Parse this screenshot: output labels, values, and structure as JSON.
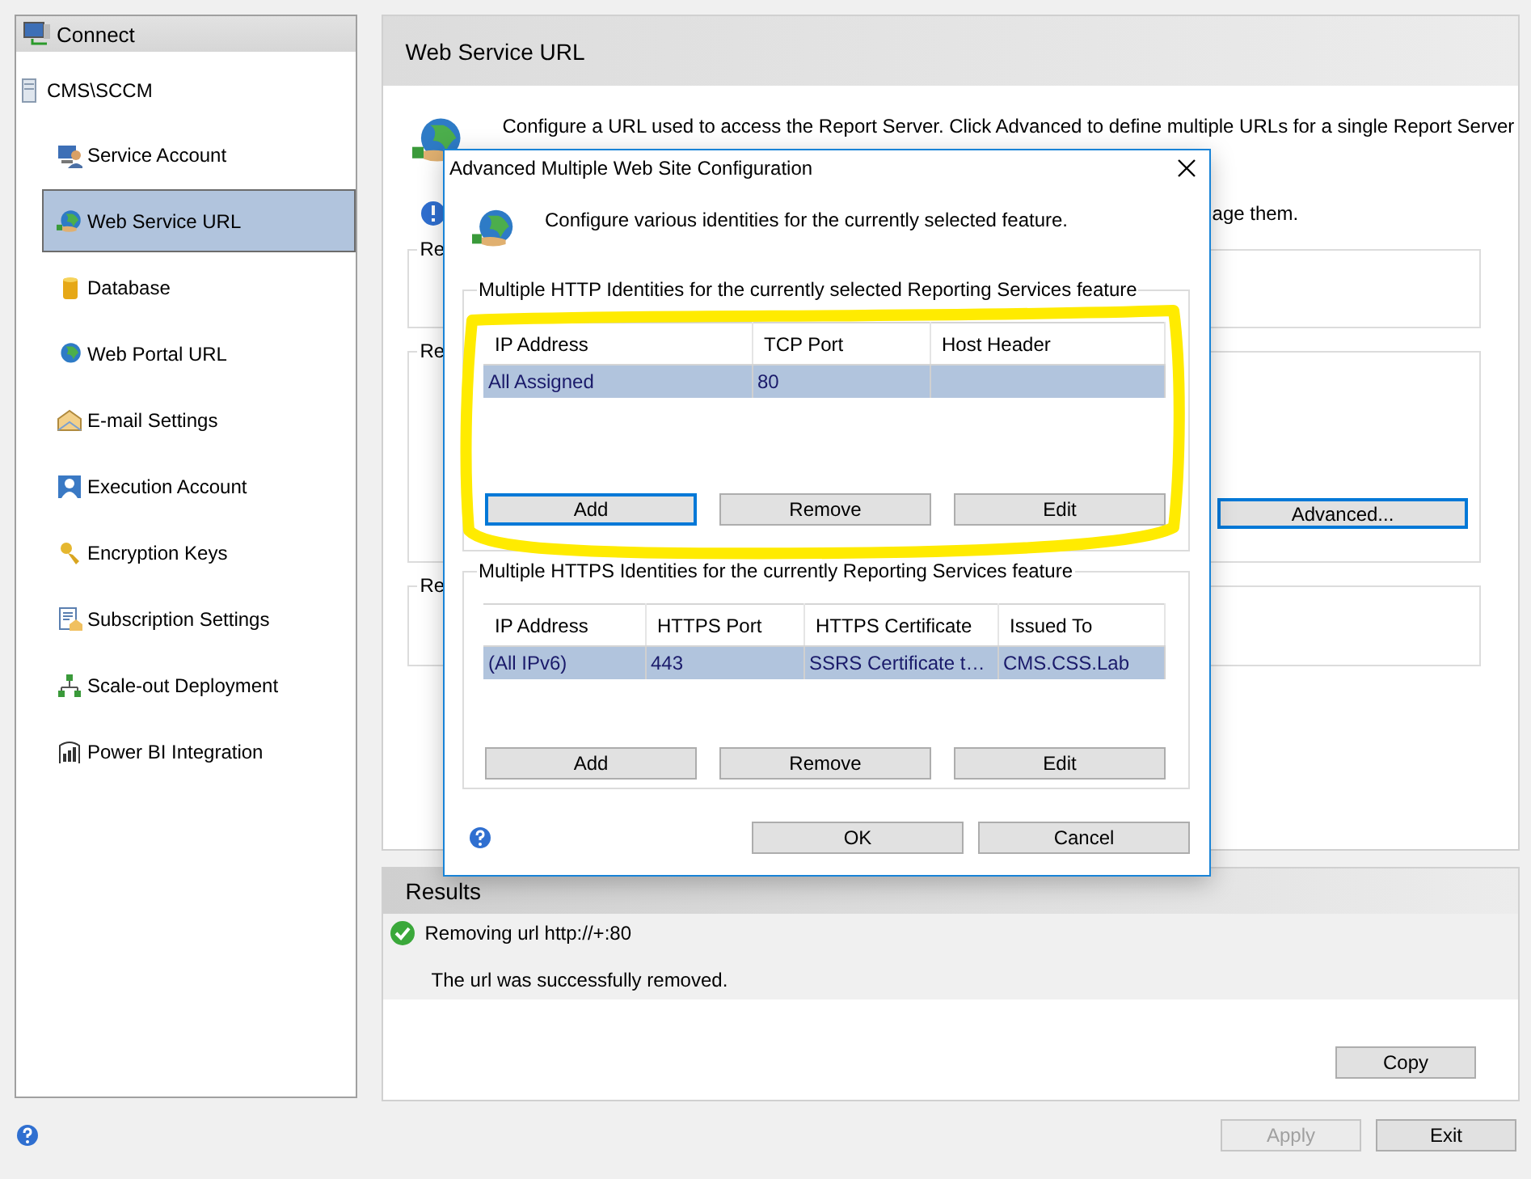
{
  "sidebar": {
    "title": "Connect",
    "server": "CMS\\SCCM",
    "items": [
      {
        "label": "Service Account",
        "selected": false
      },
      {
        "label": "Web Service URL",
        "selected": true
      },
      {
        "label": "Database",
        "selected": false
      },
      {
        "label": "Web Portal URL",
        "selected": false
      },
      {
        "label": "E-mail Settings",
        "selected": false
      },
      {
        "label": "Execution Account",
        "selected": false
      },
      {
        "label": "Encryption Keys",
        "selected": false
      },
      {
        "label": "Subscription Settings",
        "selected": false
      },
      {
        "label": "Scale-out Deployment",
        "selected": false
      },
      {
        "label": "Power BI Integration",
        "selected": false
      }
    ]
  },
  "page": {
    "title": "Web Service URL",
    "intro": "Configure a URL used to access the Report Server.  Click Advanced to define multiple URLs for a single Report Server",
    "info_fragment": "age them.",
    "groups": [
      {
        "legend": "Re"
      },
      {
        "legend": "Re",
        "button": {
          "label": "Advanced...",
          "focused": true
        }
      },
      {
        "legend": "Re"
      }
    ]
  },
  "dialog": {
    "title": "Advanced Multiple Web Site Configuration",
    "intro": "Configure various identities for the currently selected feature.",
    "sections": [
      {
        "legend": "Multiple HTTP Identities for the currently selected Reporting Services feature",
        "columns": [
          "IP Address",
          "TCP Port",
          "Host Header"
        ],
        "rows": [
          {
            "cells": [
              "All Assigned",
              "80"
            ],
            "selected": true
          }
        ],
        "buttons": [
          {
            "label": "Add",
            "focused": true
          },
          {
            "label": "Remove",
            "focused": false
          },
          {
            "label": "Edit",
            "focused": false
          }
        ]
      },
      {
        "legend": "Multiple HTTPS Identities for the currently Reporting Services feature",
        "columns": [
          "IP Address",
          "HTTPS Port",
          "HTTPS Certificate",
          "Issued To"
        ],
        "rows": [
          {
            "cells": [
              "(All IPv6)",
              "443",
              "SSRS Certificate t…",
              "CMS.CSS.Lab"
            ],
            "selected": true
          }
        ],
        "buttons": [
          {
            "label": "Add",
            "focused": false
          },
          {
            "label": "Remove",
            "focused": false
          },
          {
            "label": "Edit",
            "focused": false
          }
        ]
      }
    ],
    "buttons": [
      "OK",
      "Cancel"
    ]
  },
  "results": {
    "title": "Results",
    "entries": [
      {
        "kind": "success",
        "message": "Removing url http://+:80"
      }
    ],
    "detail": "The url was successfully removed.",
    "copy": "Copy"
  },
  "footer": {
    "buttons": [
      {
        "label": "Apply",
        "disabled": true
      },
      {
        "label": "Exit",
        "disabled": false
      }
    ]
  }
}
